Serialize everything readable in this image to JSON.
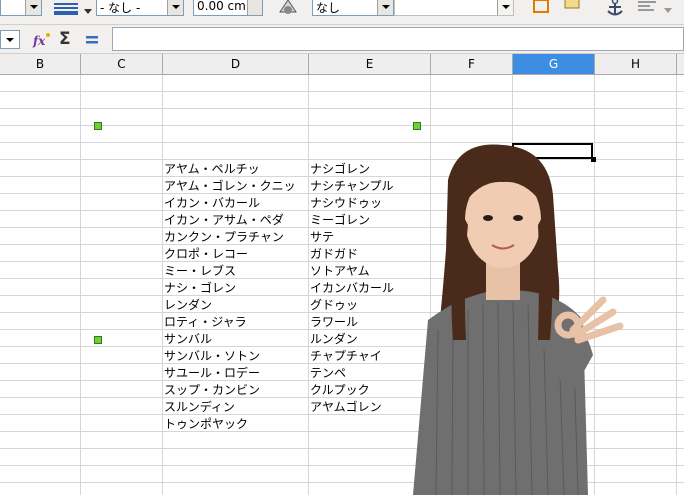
{
  "toolbar": {
    "line_style_value": "- なし -",
    "line_width_value": "0.00 cm",
    "area_style_value": "なし"
  },
  "columns": [
    "B",
    "C",
    "D",
    "E",
    "F",
    "G",
    "H"
  ],
  "selected_column": "G",
  "column_d": [
    "アヤム・ペルチッ",
    "アヤム・ゴレン・クニッ",
    "イカン・バカール",
    "イカン・アサム・ペダ",
    "カンクン・プラチャン",
    "クロポ・レコー",
    "ミー・レブス",
    "ナシ・ゴレン",
    "レンダン",
    "ロティ・ジャラ",
    "サンバル",
    "サンバル・ソトン",
    "サユール・ロデー",
    "スップ・カンビン",
    "スルンディン",
    "トゥンポヤック"
  ],
  "column_e": [
    "ナシゴレン",
    "ナシチャンプル",
    "ナシウドゥッ",
    "ミーゴレン",
    "サテ",
    "ガドガド",
    "ソトアヤム",
    "イカンバカール",
    "グドゥッ",
    "ラワール",
    "ルンダン",
    "チャプチャイ",
    "テンペ",
    "クルプック",
    "アヤムゴレン"
  ],
  "colors": {
    "selected_header": "#3d8ee3",
    "handle": "#6fcf3a"
  }
}
